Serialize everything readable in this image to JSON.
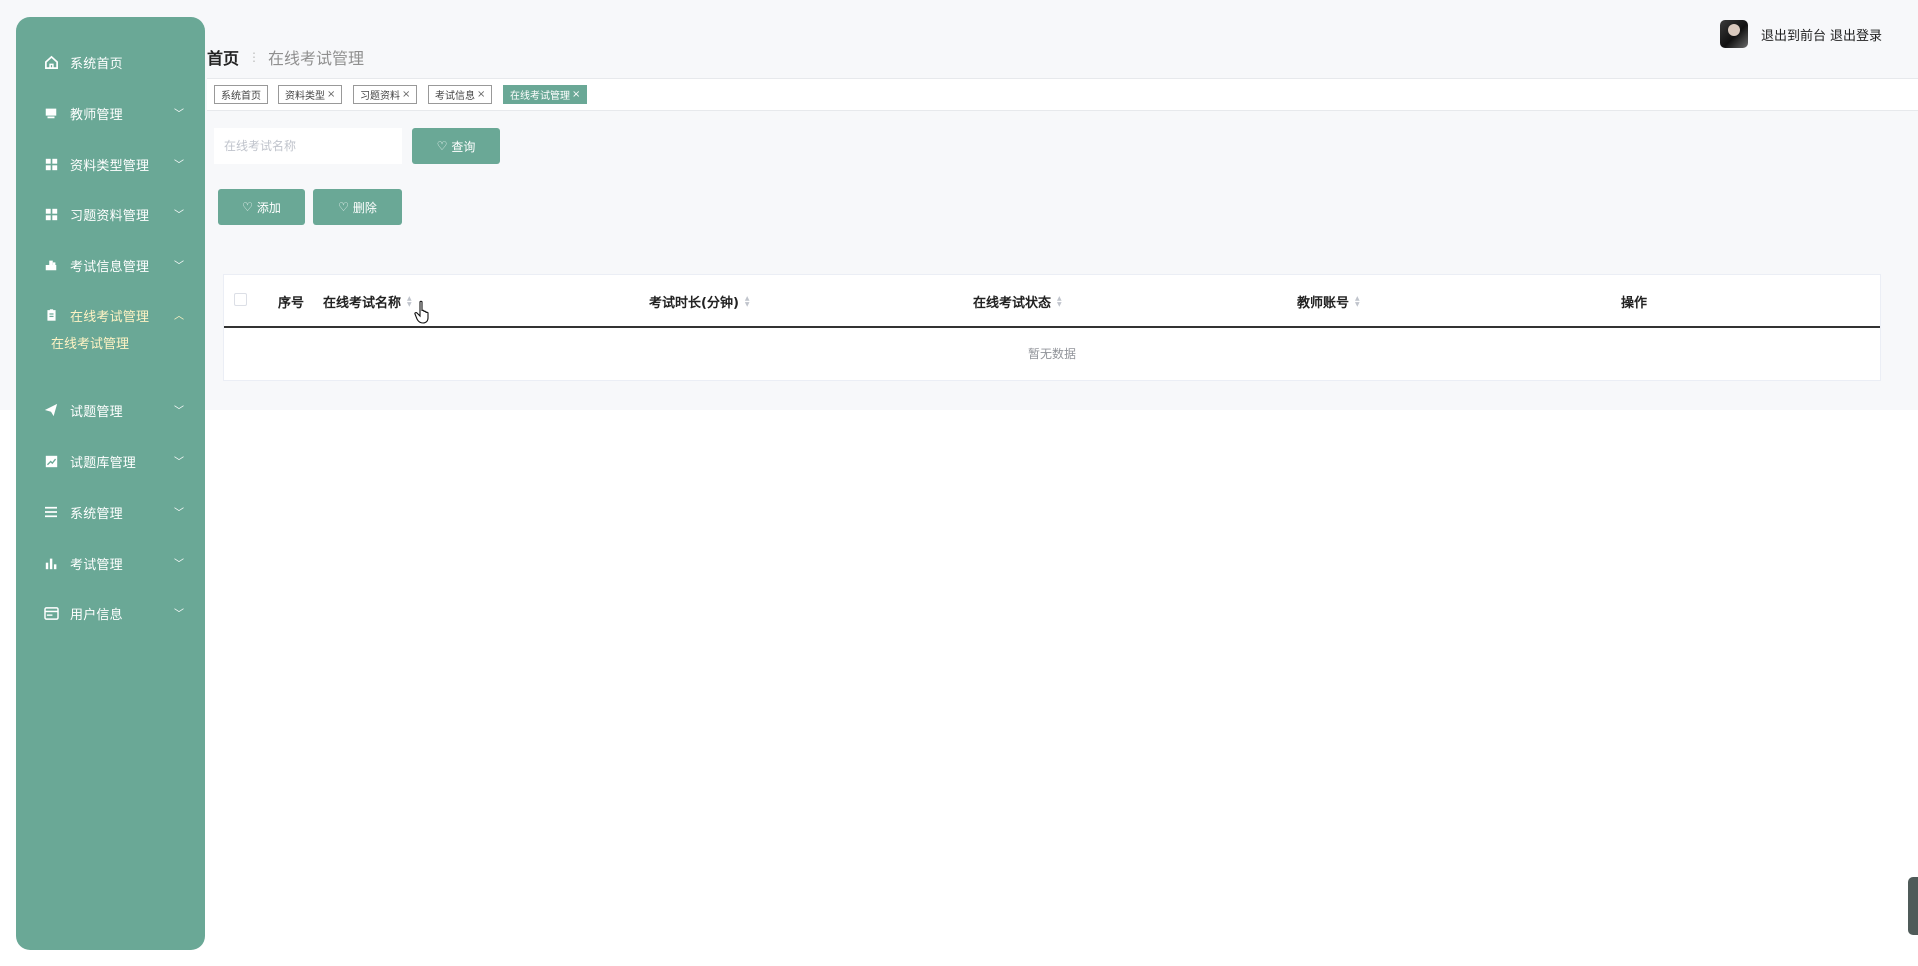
{
  "sidebar": {
    "items": [
      {
        "label": "系统首页",
        "icon": "home-icon",
        "arrow": ""
      },
      {
        "label": "教师管理",
        "icon": "monitor-icon",
        "arrow": "﹀"
      },
      {
        "label": "资料类型管理",
        "icon": "grid-icon",
        "arrow": "﹀"
      },
      {
        "label": "习题资料管理",
        "icon": "grid-icon",
        "arrow": "﹀"
      },
      {
        "label": "考试信息管理",
        "icon": "stamp-icon",
        "arrow": "﹀"
      },
      {
        "label": "在线考试管理",
        "icon": "clipboard-icon",
        "arrow": "︿"
      },
      {
        "label": "试题管理",
        "icon": "send-icon",
        "arrow": "﹀"
      },
      {
        "label": "试题库管理",
        "icon": "chart-square-icon",
        "arrow": "﹀"
      },
      {
        "label": "系统管理",
        "icon": "list-icon",
        "arrow": "﹀"
      },
      {
        "label": "考试管理",
        "icon": "bar-chart-icon",
        "arrow": "﹀"
      },
      {
        "label": "用户信息",
        "icon": "card-icon",
        "arrow": "﹀"
      }
    ],
    "submenu": {
      "label": "在线考试管理"
    }
  },
  "header": {
    "breadcrumb_home": "首页",
    "breadcrumb_sep": "⋮",
    "breadcrumb_current": "在线考试管理",
    "back_to_front": "退出到前台",
    "logout": "退出登录"
  },
  "tags": [
    {
      "label": "系统首页",
      "closable": false
    },
    {
      "label": "资料类型",
      "closable": true
    },
    {
      "label": "习题资料",
      "closable": true
    },
    {
      "label": "考试信息",
      "closable": true
    },
    {
      "label": "在线考试管理",
      "closable": true,
      "active": true
    }
  ],
  "tag_close": "×",
  "search": {
    "placeholder": "在线考试名称",
    "value": "",
    "button_label": "查询"
  },
  "actions": {
    "add_label": "添加",
    "delete_label": "删除"
  },
  "table": {
    "columns": [
      "序号",
      "在线考试名称",
      "考试时长(分钟)",
      "在线考试状态",
      "教师账号",
      "操作"
    ],
    "rows": [],
    "empty_text": "暂无数据"
  },
  "colors": {
    "accent": "#6aa896",
    "active_text": "#fff3c4"
  }
}
